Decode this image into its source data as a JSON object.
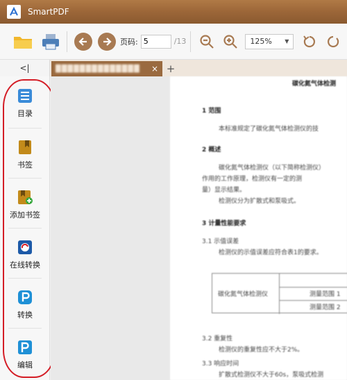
{
  "app": {
    "title": "SmartPDF"
  },
  "toolbar": {
    "page_label": "页码:",
    "page_value": "5",
    "page_total": "/13",
    "zoom_value": "125%"
  },
  "tabs": {
    "collapse_glyph": "<|",
    "doc_tab_name": "██████████████",
    "close_glyph": "×",
    "add_glyph": "+"
  },
  "sidebar": {
    "items": [
      {
        "label": "目录",
        "icon": "toc-icon",
        "color": "#3a8bd8"
      },
      {
        "label": "书签",
        "icon": "bookmark-icon",
        "color": "#c28a1a"
      },
      {
        "label": "添加书签",
        "icon": "add-bookmark-icon",
        "color": "#c28a1a"
      },
      {
        "label": "在线转换",
        "icon": "online-convert-icon",
        "color": "#1d5aa8"
      },
      {
        "label": "转换",
        "icon": "convert-icon",
        "color": "#1e90d6"
      },
      {
        "label": "编辑",
        "icon": "edit-icon",
        "color": "#1e90d6"
      }
    ]
  },
  "document": {
    "title": "碳化氮气体检测",
    "lines": [
      {
        "text": "1  范围",
        "heading": true
      },
      {
        "text": "本标准规定了碳化氮气体检测仪的技",
        "heading": false
      },
      {
        "text": "2  概述",
        "heading": true
      },
      {
        "text": "碳化氮气体检测仪（以下简称检测仪）",
        "heading": false
      },
      {
        "text": "作用的工作原理，检测仪有一定的测",
        "heading": false
      },
      {
        "text": "量）显示结果。",
        "heading": false
      },
      {
        "text": "检测仪分为扩散式和泵吸式。",
        "heading": false
      },
      {
        "text": "3  计量性能要求",
        "heading": true
      },
      {
        "text": "3.1  示值误差",
        "heading": false
      },
      {
        "text": "检测仪的示值误差应符合表1的要求。",
        "heading": false
      },
      {
        "text": "3.2  重复性",
        "heading": false
      },
      {
        "text": "检测仪的重复性应不大于2%。",
        "heading": false
      },
      {
        "text": "3.3  响应时间",
        "heading": false
      },
      {
        "text": "扩散式检测仪不大于60s，泵吸式检测",
        "heading": false
      }
    ],
    "table": {
      "left_cell": "碳化氮气体检测仪",
      "right_cells": [
        "测量范围 1",
        "测量范围 2"
      ]
    }
  },
  "colors": {
    "accent": "#a87a52",
    "titlebar": "#9c6638",
    "tab": "#9a6a3f",
    "annotation": "#d41d26"
  }
}
